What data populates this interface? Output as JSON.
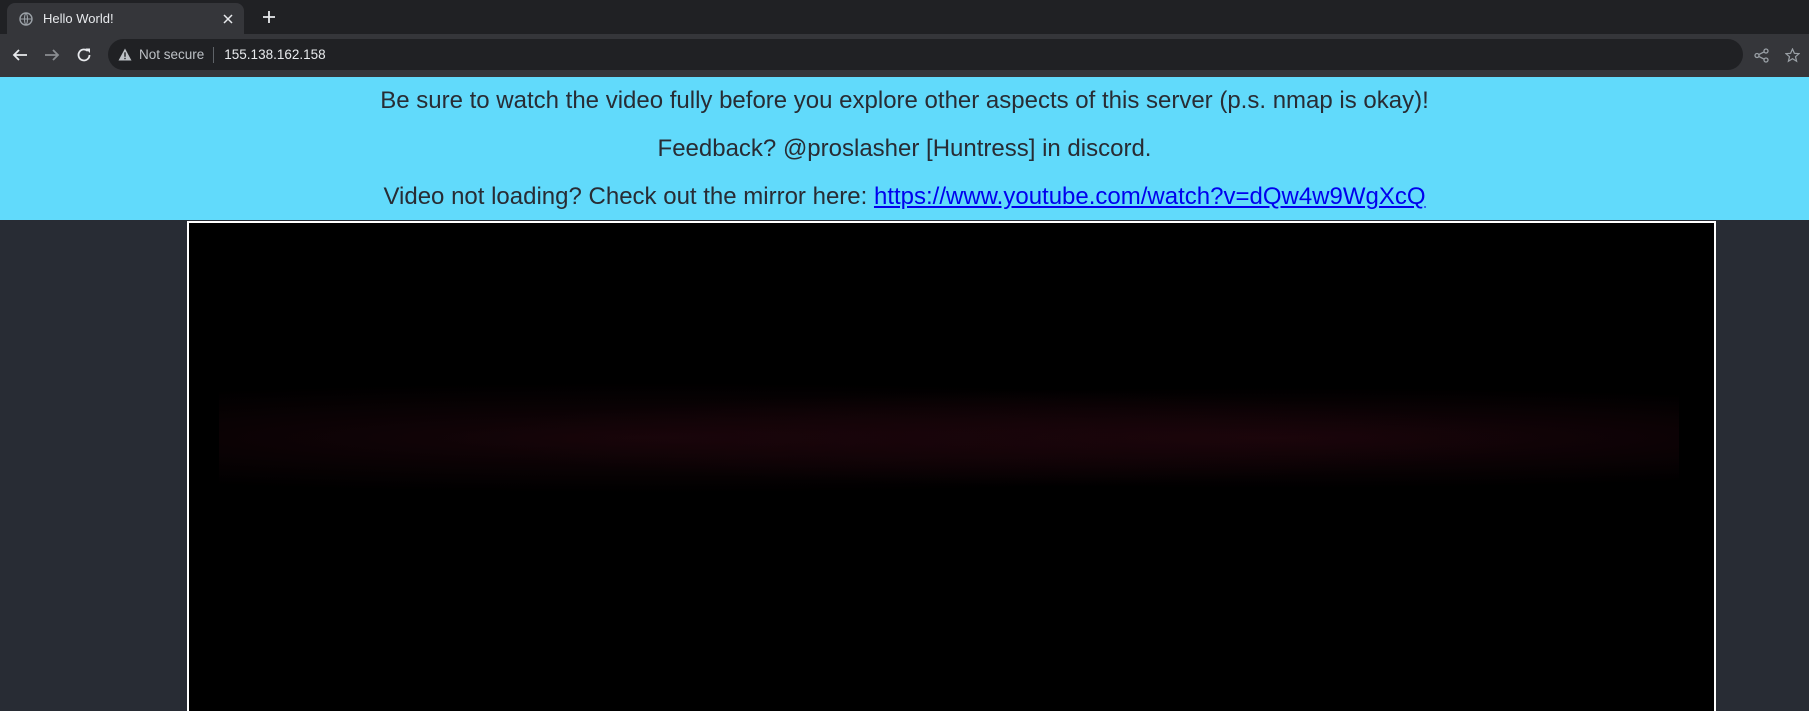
{
  "browser": {
    "tab": {
      "title": "Hello World!",
      "favicon": "globe-icon",
      "close_icon": "close-icon"
    },
    "new_tab_icon": "plus-icon",
    "toolbar": {
      "back_icon": "arrow-left-icon",
      "forward_icon": "arrow-right-icon",
      "reload_icon": "reload-icon",
      "security_label": "Not secure",
      "url": "155.138.162.158",
      "share_icon": "share-icon",
      "bookmark_icon": "star-icon"
    }
  },
  "page": {
    "banner_color": "#61dafb",
    "background_color": "#282c34",
    "line1": "Be sure to watch the video fully before you explore other aspects of this server (p.s. nmap is okay)!",
    "line2": "Feedback? @proslasher [Huntress] in discord.",
    "line3_prefix": "Video not loading? Check out the mirror here: ",
    "mirror_link": "https://www.youtube.com/watch?v=dQw4w9WgXcQ",
    "video_player": "video-player"
  }
}
